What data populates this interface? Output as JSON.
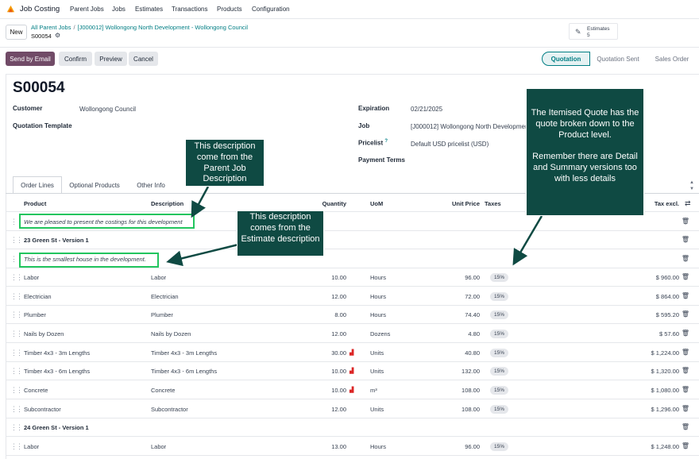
{
  "app": {
    "title": "Job Costing"
  },
  "menu": [
    "Parent Jobs",
    "Jobs",
    "Estimates",
    "Transactions",
    "Products",
    "Configuration"
  ],
  "control": {
    "new_label": "New",
    "breadcrumb": [
      "All Parent Jobs",
      "[J000012] Wollongong North Development - Wollongong Council"
    ],
    "record": "S00054",
    "smart_button": {
      "label": "Estimates",
      "count": "5"
    }
  },
  "actions": [
    "Send by Email",
    "Confirm",
    "Preview",
    "Cancel"
  ],
  "statusbar": [
    "Quotation",
    "Quotation Sent",
    "Sales Order"
  ],
  "form": {
    "title": "S00054",
    "customer_label": "Customer",
    "customer": "Wollongong Council",
    "template_label": "Quotation Template",
    "expiration_label": "Expiration",
    "expiration": "02/21/2025",
    "job_label": "Job",
    "job": "[J000012] Wollongong North Development",
    "pricelist_label": "Pricelist",
    "pricelist_hint": "?",
    "pricelist": "Default USD pricelist (USD)",
    "payment_terms_label": "Payment Terms"
  },
  "tabs": [
    "Order Lines",
    "Optional Products",
    "Other Info"
  ],
  "table": {
    "headers": {
      "product": "Product",
      "description": "Description",
      "quantity": "Quantity",
      "uom": "UoM",
      "unit_price": "Unit Price",
      "taxes": "Taxes",
      "tax_excl": "Tax excl."
    },
    "rows": [
      {
        "type": "note",
        "text": "We are pleased to present the costings for this development"
      },
      {
        "type": "section",
        "text": "23 Green St - Version 1"
      },
      {
        "type": "note",
        "text": "This is the smallest house in the development."
      },
      {
        "type": "line",
        "product": "Labor",
        "description": "Labor",
        "qty": "10.00",
        "uom": "Hours",
        "price": "96.00",
        "tax": "15%",
        "total": "$ 960.00",
        "chart": false
      },
      {
        "type": "line",
        "product": "Electrician",
        "description": "Electrician",
        "qty": "12.00",
        "uom": "Hours",
        "price": "72.00",
        "tax": "15%",
        "total": "$ 864.00",
        "chart": false
      },
      {
        "type": "line",
        "product": "Plumber",
        "description": "Plumber",
        "qty": "8.00",
        "uom": "Hours",
        "price": "74.40",
        "tax": "15%",
        "total": "$ 595.20",
        "chart": false
      },
      {
        "type": "line",
        "product": "Nails by Dozen",
        "description": "Nails by Dozen",
        "qty": "12.00",
        "uom": "Dozens",
        "price": "4.80",
        "tax": "15%",
        "total": "$ 57.60",
        "chart": false
      },
      {
        "type": "line",
        "product": "Timber 4x3 - 3m Lengths",
        "description": "Timber 4x3 - 3m Lengths",
        "qty": "30.00",
        "uom": "Units",
        "price": "40.80",
        "tax": "15%",
        "total": "$ 1,224.00",
        "chart": true
      },
      {
        "type": "line",
        "product": "Timber 4x3 - 6m Lengths",
        "description": "Timber 4x3 - 6m Lengths",
        "qty": "10.00",
        "uom": "Units",
        "price": "132.00",
        "tax": "15%",
        "total": "$ 1,320.00",
        "chart": true
      },
      {
        "type": "line",
        "product": "Concrete",
        "description": "Concrete",
        "qty": "10.00",
        "uom": "m³",
        "price": "108.00",
        "tax": "15%",
        "total": "$ 1,080.00",
        "chart": true
      },
      {
        "type": "line",
        "product": "Subcontractor",
        "description": "Subcontractor",
        "qty": "12.00",
        "uom": "Units",
        "price": "108.00",
        "tax": "15%",
        "total": "$ 1,296.00",
        "chart": false
      },
      {
        "type": "section",
        "text": "24 Green St - Version 1"
      },
      {
        "type": "line",
        "product": "Labor",
        "description": "Labor",
        "qty": "13.00",
        "uom": "Hours",
        "price": "96.00",
        "tax": "15%",
        "total": "$ 1,248.00",
        "chart": false
      }
    ]
  },
  "annotations": {
    "parent_desc": "This description come from the Parent Job Description",
    "estimate_desc": "This description comes from the Estimate description",
    "itemised_1": "The Itemised Quote has the quote broken down to the Product level.",
    "itemised_2": "Remember there are Detail and Summary versions too with less details"
  },
  "colors": {
    "brand": "#714b67",
    "accent": "#017e84",
    "callout": "#0f4a43",
    "highlight": "#22c55e"
  }
}
